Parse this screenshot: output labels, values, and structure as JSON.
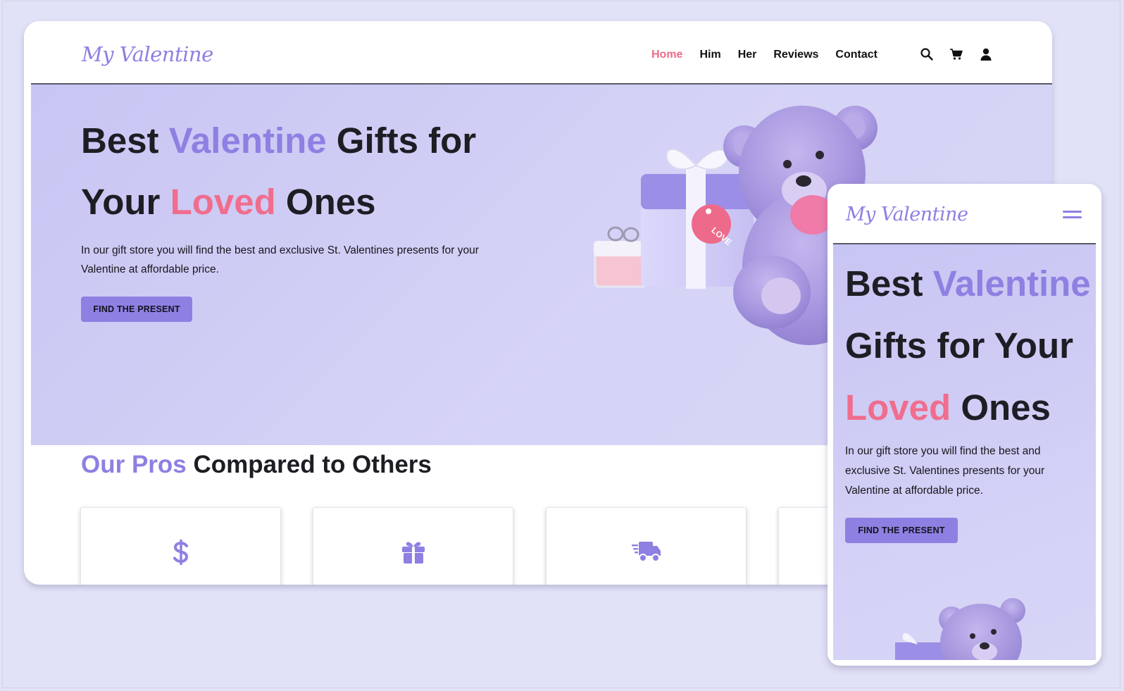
{
  "brand": "My Valentine",
  "colors": {
    "accent": "#8d80e2",
    "pink": "#f06d8d",
    "hero_bg": "#cfccf5",
    "page_bg": "#e1e1f7"
  },
  "nav": {
    "items": [
      "Home",
      "Him",
      "Her",
      "Reviews",
      "Contact"
    ],
    "active": "Home",
    "icons": [
      "search-icon",
      "cart-icon",
      "user-icon"
    ]
  },
  "hero": {
    "title_line1": {
      "word1": "Best ",
      "highlight": "Valentine",
      "word2": " Gifts for"
    },
    "title_line2": {
      "word1": "Your ",
      "highlight": "Loved",
      "word2": " Ones"
    },
    "mobile_title": {
      "best": "Best ",
      "valentine": "Valentine",
      "gifts": "Gifts for Your",
      "loved": "Loved",
      "ones": " Ones"
    },
    "description": "In our gift store you will find the best and exclusive St. Valentines presents for your Valentine at affordable price.",
    "cta": "FIND THE PRESENT",
    "tag_text": "LOVE"
  },
  "pros": {
    "title_highlight": "Our Pros",
    "title_rest": " Compared to Others",
    "cards": [
      "dollar-icon",
      "gift-icon",
      "truck-icon"
    ]
  },
  "mobile": {
    "menu_icon": "hamburger-icon"
  }
}
